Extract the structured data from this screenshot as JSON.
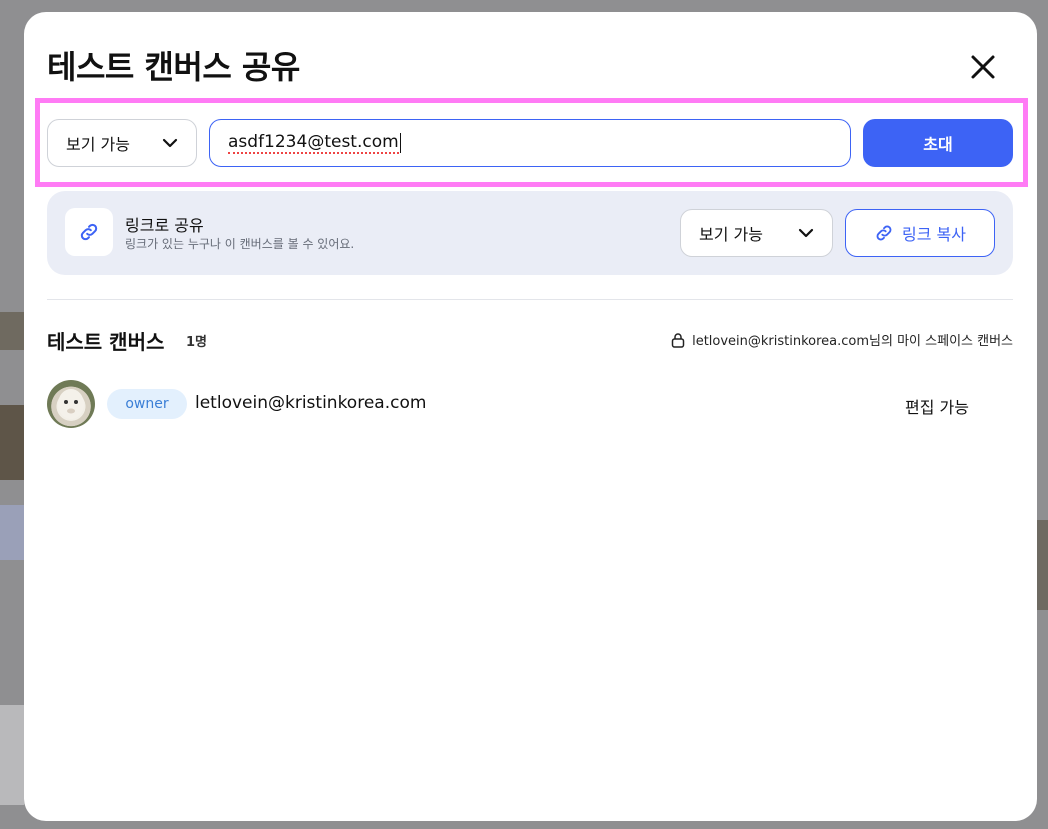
{
  "dialog": {
    "title": "테스트 캔버스 공유"
  },
  "invite": {
    "permission_label": "보기 가능",
    "email_value": "asdf1234@test.com",
    "invite_label": "초대"
  },
  "link_share": {
    "title": "링크로 공유",
    "description": "링크가 있는 누구나 이 캔버스를 볼 수 있어요.",
    "permission_label": "보기 가능",
    "copy_label": "링크 복사"
  },
  "members_section": {
    "canvas_name": "테스트 캔버스",
    "count": "1명",
    "owner_space": "letlovein@kristinkorea.com님의 마이 스페이스 캔버스"
  },
  "members": [
    {
      "role": "owner",
      "email": "letlovein@kristinkorea.com",
      "permission": "편집 가능"
    }
  ],
  "colors": {
    "accent": "#3d63f5",
    "highlight": "#ff7bf5",
    "panel": "#eaedf6",
    "badge_bg": "#e3f0fd",
    "badge_text": "#3b7fd6"
  }
}
